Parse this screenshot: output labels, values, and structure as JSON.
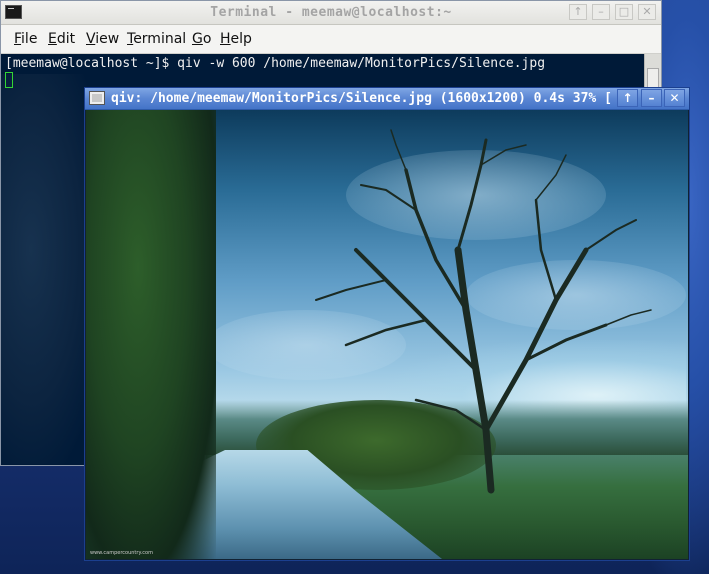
{
  "terminal": {
    "title": "Terminal - meemaw@localhost:~",
    "menu": [
      {
        "label": "File",
        "underline": "F",
        "rest": "ile"
      },
      {
        "label": "Edit",
        "underline": "E",
        "rest": "dit"
      },
      {
        "label": "View",
        "underline": "V",
        "rest": "iew"
      },
      {
        "label": "Terminal",
        "underline": "T",
        "rest": "erminal"
      },
      {
        "label": "Go",
        "underline": "G",
        "rest": "o"
      },
      {
        "label": "Help",
        "underline": "H",
        "rest": "elp"
      }
    ],
    "command_line": "[meemaw@localhost ~]$ qiv -w 600 /home/meemaw/MonitorPics/Silence.jpg",
    "buttons": {
      "up": "↑",
      "minimize": "–",
      "maximize": "□",
      "close": "✕"
    }
  },
  "qiv": {
    "title": "qiv: /home/meemaw/MonitorPics/Silence.jpg (1600x1200) 0.4s 37% [",
    "buttons": {
      "up": "↑",
      "minimize": "–",
      "close": "✕"
    },
    "image_watermark": "www.campercountry.com"
  },
  "colors": {
    "terminal_bg": "#001a38",
    "cursor": "#34d634",
    "qiv_titlebar": "#5a86d3"
  },
  "icons": [
    "terminal-app-icon",
    "image-viewer-app-icon",
    "up-arrow-icon",
    "minimize-icon",
    "maximize-icon",
    "close-icon"
  ]
}
